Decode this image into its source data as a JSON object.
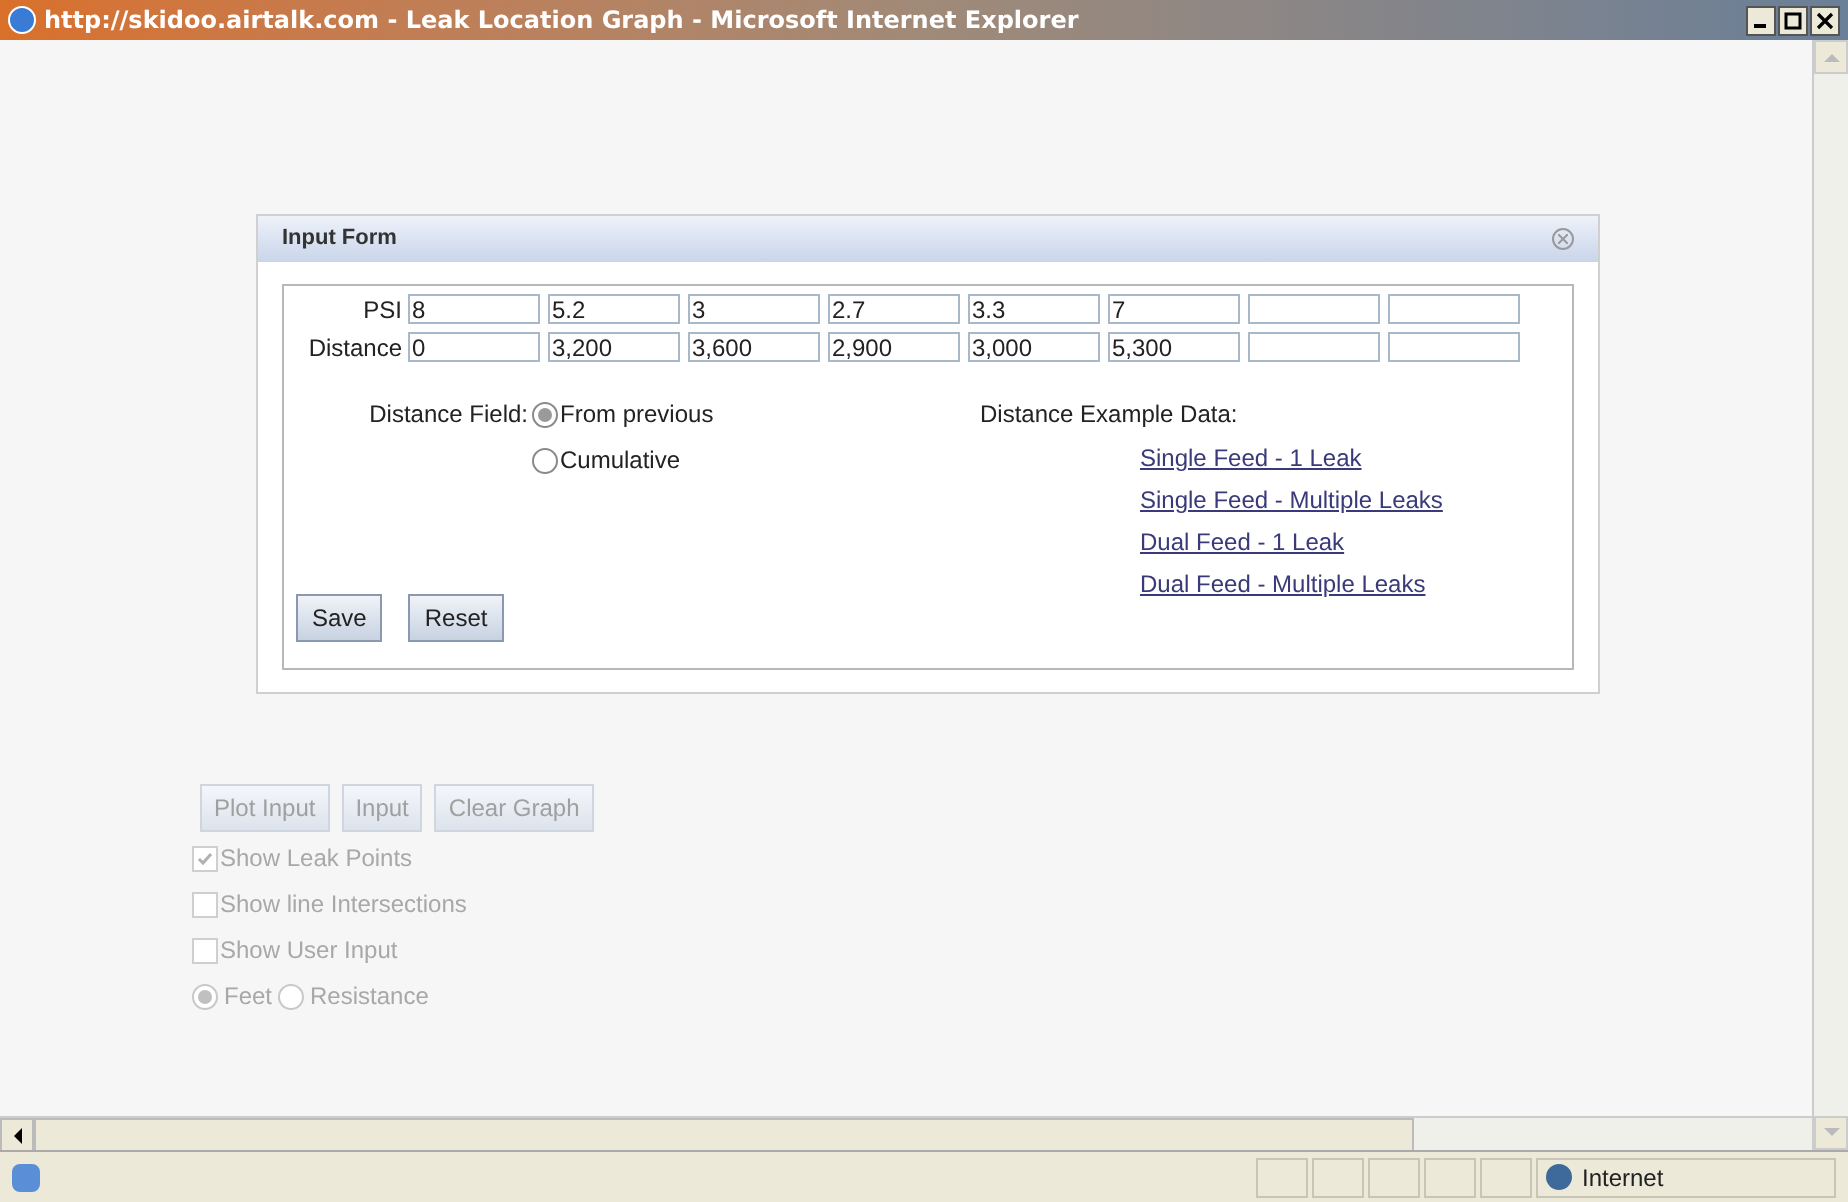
{
  "window": {
    "title": "http://skidoo.airtalk.com - Leak Location Graph - Microsoft Internet Explorer"
  },
  "dialog": {
    "title": "Input Form",
    "rows": [
      {
        "label": "PSI",
        "cells": [
          {
            "value": "8"
          },
          {
            "value": "5.2"
          },
          {
            "value": "3"
          },
          {
            "value": "2.7"
          },
          {
            "value": "3.3"
          },
          {
            "value": "7"
          },
          {},
          {}
        ]
      },
      {
        "label": "Distance",
        "cells": [
          {
            "value": "0"
          },
          {
            "value": "3,200"
          },
          {
            "value": "3,600"
          },
          {
            "value": "2,900"
          },
          {
            "value": "3,000"
          },
          {
            "value": "5,300"
          },
          {},
          {}
        ]
      }
    ],
    "distance_field": {
      "label": "Distance Field:",
      "options": [
        {
          "label": "From previous",
          "selected": true
        },
        {
          "label": "Cumulative",
          "selected": false
        }
      ]
    },
    "examples": {
      "label": "Distance Example Data:",
      "links": [
        "Single Feed - 1 Leak",
        "Single Feed - Multiple Leaks",
        "Dual Feed - 1 Leak",
        "Dual Feed - Multiple Leaks"
      ]
    },
    "buttons": [
      "Save",
      "Reset"
    ]
  },
  "graph_controls": {
    "buttons": [
      {
        "label": "Plot Input",
        "disabled": true
      },
      {
        "label": "Input",
        "disabled": true
      },
      {
        "label": "Clear Graph",
        "disabled": true
      }
    ],
    "checkboxes": [
      {
        "label": "Show Leak Points",
        "checked": true,
        "disabled": true
      },
      {
        "label": "Show line Intersections",
        "checked": false,
        "disabled": true
      },
      {
        "label": "Show User Input",
        "checked": false,
        "disabled": true
      }
    ],
    "units": [
      {
        "label": "Feet",
        "selected": true,
        "disabled": true
      },
      {
        "label": "Resistance",
        "selected": false,
        "disabled": true
      }
    ]
  },
  "status_bar": {
    "zone": "Internet"
  }
}
